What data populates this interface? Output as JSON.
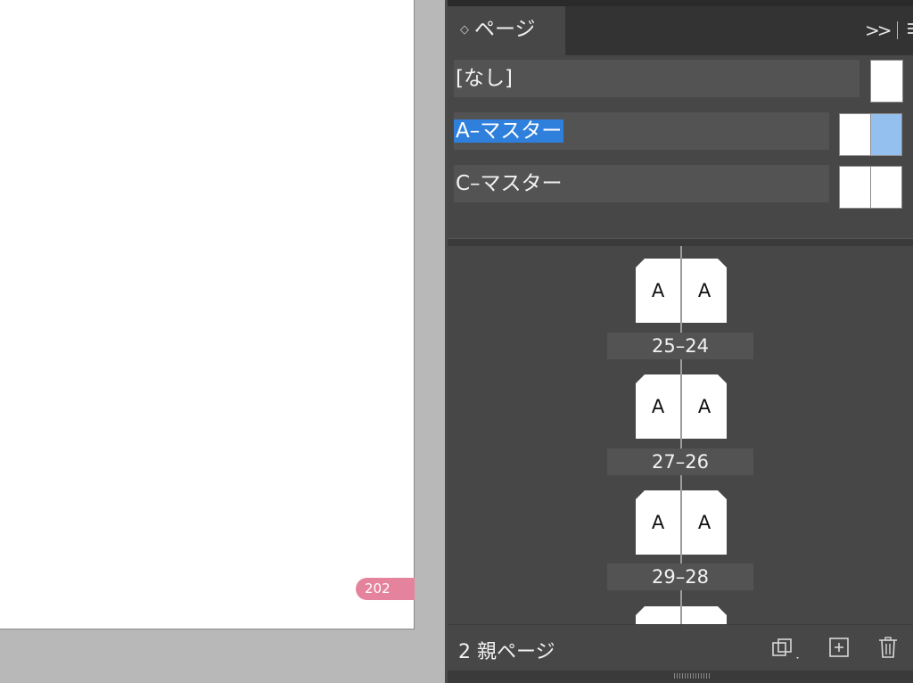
{
  "document": {
    "page_number_tag": "202"
  },
  "panel": {
    "tab_label": "ページ",
    "tab_icon": "updown-arrows-icon",
    "collapse_icon": ">>",
    "menu_icon": "panel-menu-icon"
  },
  "masters": [
    {
      "label": "[なし]",
      "selected": false,
      "thumb": "single"
    },
    {
      "label": "A–マスター",
      "selected": true,
      "thumb": "spread"
    },
    {
      "label": "C–マスター",
      "selected": false,
      "thumb": "spread"
    }
  ],
  "spreads": [
    {
      "left_master": "A",
      "right_master": "A",
      "page_range": "25–24"
    },
    {
      "left_master": "A",
      "right_master": "A",
      "page_range": "27–26"
    },
    {
      "left_master": "A",
      "right_master": "A",
      "page_range": "29–28"
    }
  ],
  "footer": {
    "status": "2 親ページ",
    "icons": [
      "edit-page-size-icon",
      "new-page-icon",
      "trash-icon"
    ]
  },
  "colors": {
    "selection": "#2f7fdc",
    "page_tag": "#e5829c",
    "panel_bg": "#474747"
  }
}
